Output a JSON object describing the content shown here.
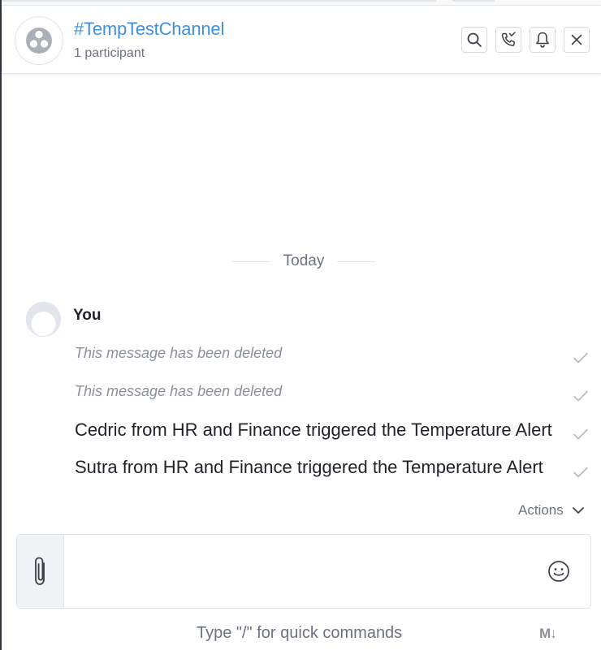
{
  "channel": {
    "title": "#TempTestChannel",
    "participants": "1 participant"
  },
  "header_actions": [
    {
      "name": "search",
      "icon": "search-icon"
    },
    {
      "name": "call",
      "icon": "phone-call-icon"
    },
    {
      "name": "notifications",
      "icon": "bell-icon"
    },
    {
      "name": "close",
      "icon": "close-icon"
    }
  ],
  "timeline": {
    "day_separator": "Today",
    "sender": "You",
    "messages": [
      {
        "text": "This message has been deleted",
        "deleted": true,
        "status": "read"
      },
      {
        "text": "This message has been deleted",
        "deleted": true,
        "status": "read"
      },
      {
        "text": "Cedric from HR and Finance triggered the Temperature Alert",
        "deleted": false,
        "status": "read"
      },
      {
        "text": "Sutra from HR and Finance triggered the Temperature Alert",
        "deleted": false,
        "status": "read"
      }
    ],
    "actions_label": "Actions"
  },
  "composer": {
    "value": "",
    "hint": "Type \"/\" for quick commands",
    "markdown_badge": "M↓"
  },
  "colors": {
    "accent": "#3f8fe0",
    "muted_text": "#6b7280",
    "check": "#b8bcc2"
  }
}
